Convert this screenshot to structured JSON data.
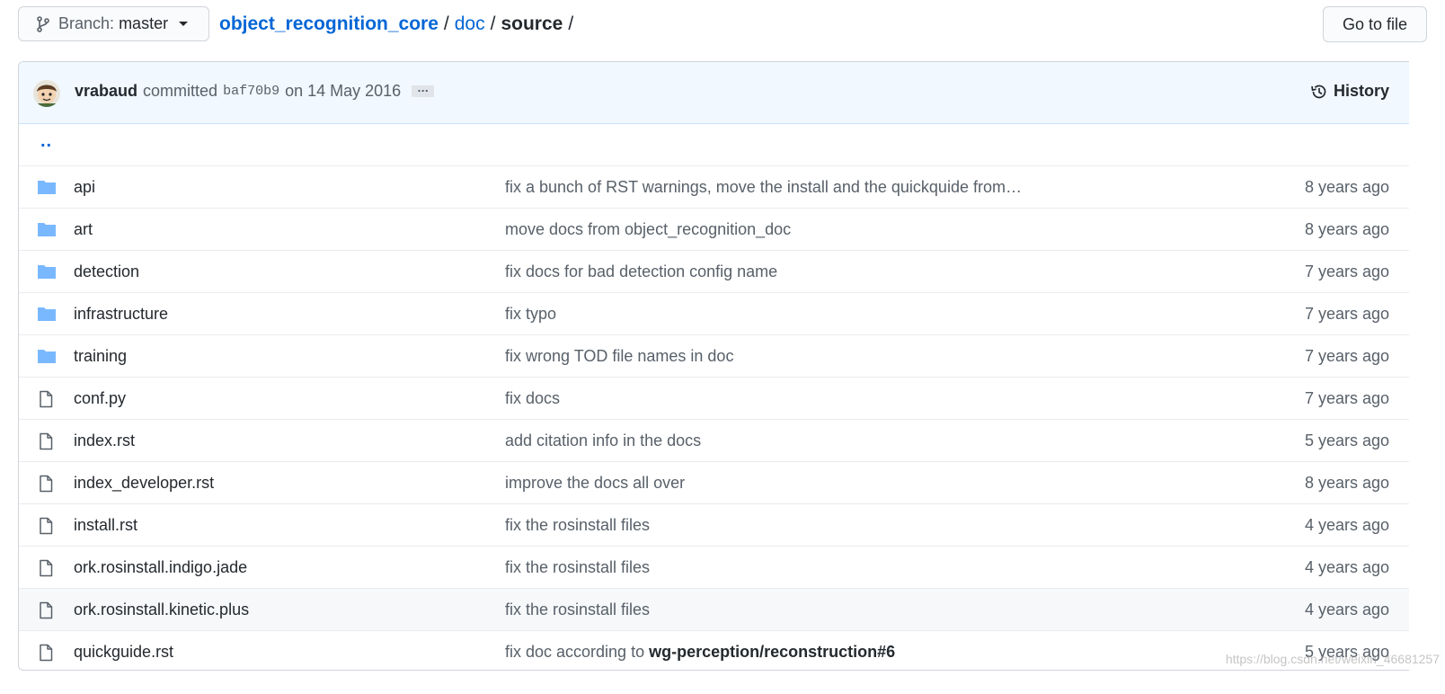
{
  "branch": {
    "label": "Branch:",
    "value": "master"
  },
  "breadcrumb": {
    "repo": "object_recognition_core",
    "sep1": "/",
    "doc": "doc",
    "sep2": "/",
    "current": "source",
    "sep3": "/"
  },
  "goto_file": "Go to file",
  "commit": {
    "author": "vrabaud",
    "verb": "committed",
    "sha": "baf70b9",
    "date": "on 14 May 2016",
    "ellipsis": "…",
    "history": "History"
  },
  "parent_dir": "..",
  "files": [
    {
      "type": "folder",
      "name": "api",
      "message": "fix a bunch of RST warnings, move the install and the quickquide from…",
      "age": "8 years ago"
    },
    {
      "type": "folder",
      "name": "art",
      "message": "move docs from object_recognition_doc",
      "age": "8 years ago"
    },
    {
      "type": "folder",
      "name": "detection",
      "message": "fix docs for bad detection config name",
      "age": "7 years ago"
    },
    {
      "type": "folder",
      "name": "infrastructure",
      "message": "fix typo",
      "age": "7 years ago"
    },
    {
      "type": "folder",
      "name": "training",
      "message": "fix wrong TOD file names in doc",
      "age": "7 years ago"
    },
    {
      "type": "file",
      "name": "conf.py",
      "message": "fix docs",
      "age": "7 years ago"
    },
    {
      "type": "file",
      "name": "index.rst",
      "message": "add citation info in the docs",
      "age": "5 years ago"
    },
    {
      "type": "file",
      "name": "index_developer.rst",
      "message": "improve the docs all over",
      "age": "8 years ago"
    },
    {
      "type": "file",
      "name": "install.rst",
      "message": "fix the rosinstall files",
      "age": "4 years ago"
    },
    {
      "type": "file",
      "name": "ork.rosinstall.indigo.jade",
      "message": "fix the rosinstall files",
      "age": "4 years ago"
    },
    {
      "type": "file",
      "name": "ork.rosinstall.kinetic.plus",
      "message": "fix the rosinstall files",
      "age": "4 years ago",
      "hover": true
    },
    {
      "type": "file",
      "name": "quickguide.rst",
      "message": "fix doc according to",
      "message_link": "wg-perception/reconstruction#6",
      "age": "5 years ago"
    }
  ],
  "watermark": "https://blog.csdn.net/weixin_46681257",
  "colors": {
    "link": "#0366d6",
    "folder": "#79b8ff",
    "commit_bg": "#f1f8ff",
    "text": "#24292e",
    "muted": "#586069"
  },
  "icons": {
    "branch": "git-branch-icon",
    "history": "history-icon",
    "folder": "folder-icon",
    "file": "file-icon"
  }
}
